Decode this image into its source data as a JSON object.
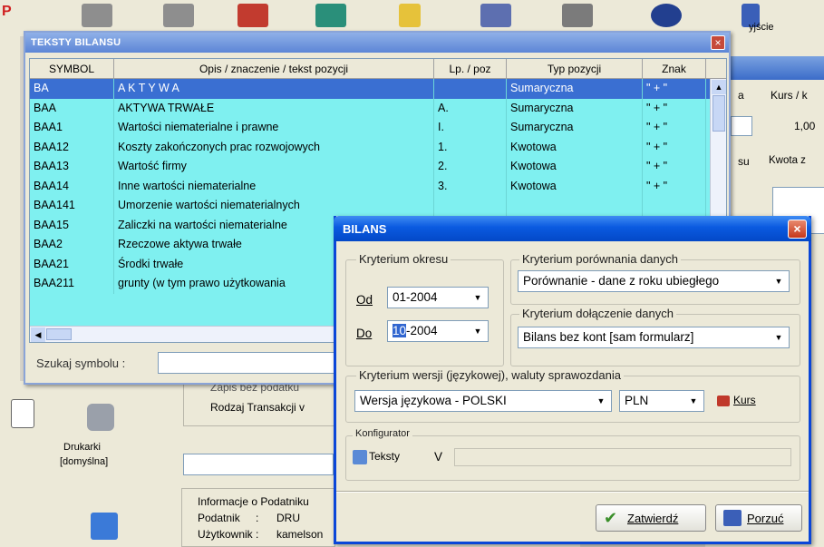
{
  "teksty_window": {
    "title": "TEKSTY BILANSU",
    "close_glyph": "×",
    "columns": [
      "SYMBOL",
      "Opis / znaczenie / tekst pozycji",
      "Lp. / poz",
      "Typ pozycji",
      "Znak"
    ],
    "rows": [
      {
        "symbol": "BA",
        "opis": "A K T Y W A",
        "lp": "",
        "typ": "Sumaryczna",
        "znak": "\" + \""
      },
      {
        "symbol": "BAA",
        "opis": "AKTYWA TRWAŁE",
        "lp": "A.",
        "typ": "Sumaryczna",
        "znak": "\" + \""
      },
      {
        "symbol": "BAA1",
        "opis": "Wartości niematerialne i prawne",
        "lp": "I.",
        "typ": "Sumaryczna",
        "znak": "\" + \""
      },
      {
        "symbol": "BAA12",
        "opis": "Koszty zakończonych prac rozwojowych",
        "lp": "1.",
        "typ": "Kwotowa",
        "znak": "\" + \""
      },
      {
        "symbol": "BAA13",
        "opis": "Wartość firmy",
        "lp": "2.",
        "typ": "Kwotowa",
        "znak": "\" + \""
      },
      {
        "symbol": "BAA14",
        "opis": "Inne wartości niematerialne",
        "lp": "3.",
        "typ": "Kwotowa",
        "znak": "\" + \""
      },
      {
        "symbol": "BAA141",
        "opis": "Umorzenie wartości niematerialnych",
        "lp": "",
        "typ": "",
        "znak": ""
      },
      {
        "symbol": "BAA15",
        "opis": "Zaliczki na wartości niematerialne",
        "lp": "",
        "typ": "",
        "znak": ""
      },
      {
        "symbol": "BAA2",
        "opis": "Rzeczowe aktywa trwałe",
        "lp": "",
        "typ": "",
        "znak": ""
      },
      {
        "symbol": "BAA21",
        "opis": "Środki trwałe",
        "lp": "",
        "typ": "",
        "znak": ""
      },
      {
        "symbol": "BAA211",
        "opis": "grunty (w tym prawo użytkowania",
        "lp": "",
        "typ": "",
        "znak": ""
      }
    ],
    "search_label": "Szukaj symbolu :",
    "search_value": ""
  },
  "bilans_dialog": {
    "title": "BILANS",
    "close_glyph": "×",
    "okres": {
      "legend": "Kryterium okresu",
      "od_label": "Od",
      "od_value": "01-2004",
      "do_label": "Do",
      "do_value_selected": "10",
      "do_value_rest": "-2004"
    },
    "porownania": {
      "legend": "Kryterium porównania danych",
      "value": "Porównanie - dane z roku ubiegłego"
    },
    "dolaczenie": {
      "legend": "Kryterium dołączenie danych",
      "value": "Bilans bez kont [sam formularz]"
    },
    "wersja": {
      "legend": "Kryterium wersji (językowej), waluty sprawozdania",
      "language_value": "Wersja językowa - POLSKI",
      "currency_value": "PLN",
      "kurs_label": "Kurs"
    },
    "konfigurator": {
      "legend": "Konfigurator",
      "teksty_label": "Teksty",
      "v_label": "V"
    },
    "buttons": {
      "zatwierdz": "Zatwierdź",
      "porzuc": "Porzuć"
    }
  },
  "background": {
    "kurs_header": "Kurs / k",
    "kurs_value": "1,00",
    "kwota_label": "Kwota z",
    "su_label": "su",
    "a_label": "a",
    "zapis_text": "Zapis bez podatku",
    "rodzaj_text": "Rodzaj Transakcji v",
    "info_legend": "Informacje o Podatniku",
    "podatnik_label": "Podatnik",
    "podatnik_value": "DRU",
    "uzytkownik_label": "Użytkownik",
    "uzytkownik_value": "kamelson",
    "drukarki_label": "Drukarki",
    "drukarki_sub": "[domyślna]",
    "zyjscie": "yjście",
    "colors": {
      "grid_bg": "#7ff0f0",
      "selection": "#3a6fd2",
      "xp_title": "#0a5ae0"
    }
  }
}
